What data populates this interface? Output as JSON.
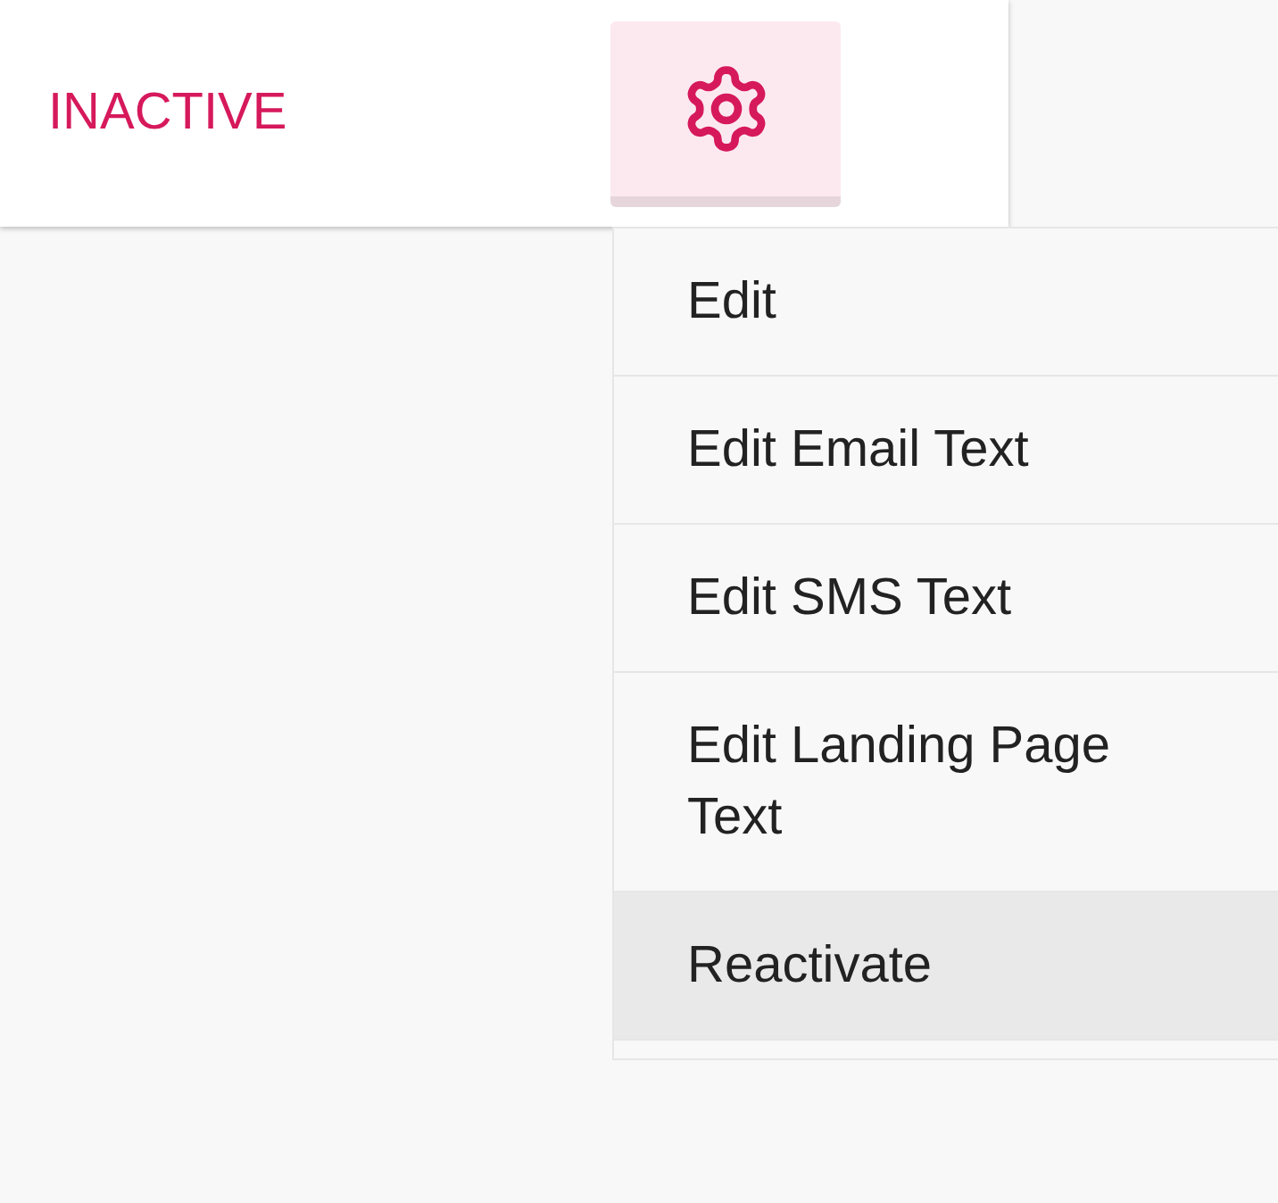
{
  "card": {
    "status": "INACTIVE",
    "settings_button": {
      "pressed": true
    }
  },
  "menu": {
    "items": [
      {
        "label": "Edit",
        "highlighted": false
      },
      {
        "label": "Edit Email Text",
        "highlighted": false
      },
      {
        "label": "Edit SMS Text",
        "highlighted": false
      },
      {
        "label": "Edit Landing Page Text",
        "highlighted": false
      },
      {
        "label": "Reactivate",
        "highlighted": true
      }
    ]
  }
}
